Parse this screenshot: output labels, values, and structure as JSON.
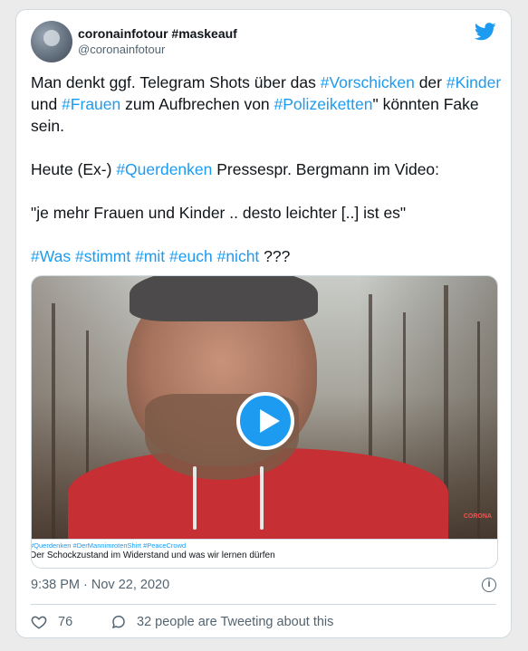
{
  "user": {
    "name": "coronainfotour #maskeauf",
    "handle": "@coronainfotour"
  },
  "tweet": {
    "p1": [
      {
        "t": "Man denkt ggf. Telegram Shots über das ",
        "tag": false
      },
      {
        "t": "#Vorschicken",
        "tag": true
      },
      {
        "t": " der ",
        "tag": false
      },
      {
        "t": "#Kinder",
        "tag": true
      },
      {
        "t": " und ",
        "tag": false
      },
      {
        "t": "#Frauen",
        "tag": true
      },
      {
        "t": " zum Aufbrechen von ",
        "tag": false
      },
      {
        "t": "#Polizeiketten",
        "tag": true
      },
      {
        "t": "\" könnten Fake sein.",
        "tag": false
      }
    ],
    "p2": [
      {
        "t": "Heute (Ex-) ",
        "tag": false
      },
      {
        "t": "#Querdenken",
        "tag": true
      },
      {
        "t": " Pressespr. Bergmann im Video:",
        "tag": false
      }
    ],
    "p3": [
      {
        "t": "\"je mehr Frauen und Kinder .. desto leichter [..] ist es\"",
        "tag": false
      }
    ],
    "p4": [
      {
        "t": "#Was",
        "tag": true
      },
      {
        "t": " ",
        "tag": false
      },
      {
        "t": "#stimmt",
        "tag": true
      },
      {
        "t": " ",
        "tag": false
      },
      {
        "t": "#mit",
        "tag": true
      },
      {
        "t": " ",
        "tag": false
      },
      {
        "t": "#euch",
        "tag": true
      },
      {
        "t": " ",
        "tag": false
      },
      {
        "t": "#nicht",
        "tag": true
      },
      {
        "t": " ???",
        "tag": false
      }
    ]
  },
  "media": {
    "tags_line": "#Querdenken #DerMannimrotenShirt #PeaceCrowd",
    "title_line": "Der Schockzustand im Widerstand und was wir lernen dürfen",
    "watermark": "CORONA"
  },
  "timestamp": "9:38 PM · Nov 22, 2020",
  "info_glyph": "i",
  "actions": {
    "likes": "76",
    "talking": "32 people are Tweeting about this"
  },
  "colors": {
    "accent": "#1d9bf0",
    "text": "#0f1419",
    "muted": "#536471",
    "hoodie": "#c62f33"
  }
}
